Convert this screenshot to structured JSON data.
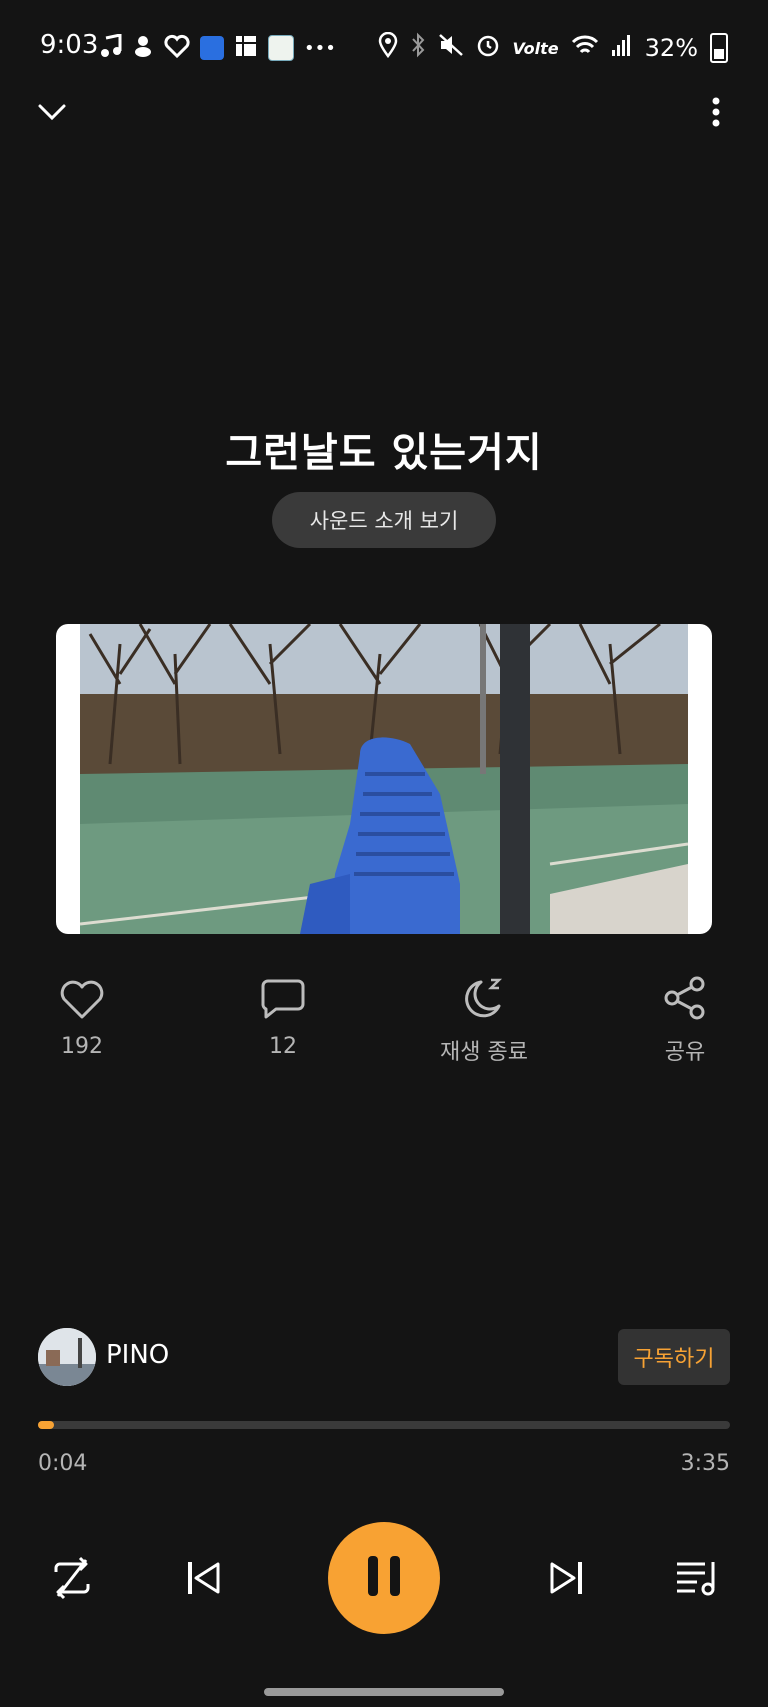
{
  "status_bar": {
    "time": "9:03",
    "battery": "32%",
    "volte": "Volte"
  },
  "track": {
    "title": "그런날도 있는거지",
    "intro_button": "사운드 소개 보기"
  },
  "actions": {
    "like_count": "192",
    "comment_count": "12",
    "sleep_label": "재생 종료",
    "share_label": "공유"
  },
  "artist": {
    "name": "PINO",
    "subscribe_label": "구독하기"
  },
  "progress": {
    "current": "0:04",
    "total": "3:35",
    "fraction": 0.019
  },
  "colors": {
    "accent": "#f7a234",
    "background": "#141414"
  }
}
